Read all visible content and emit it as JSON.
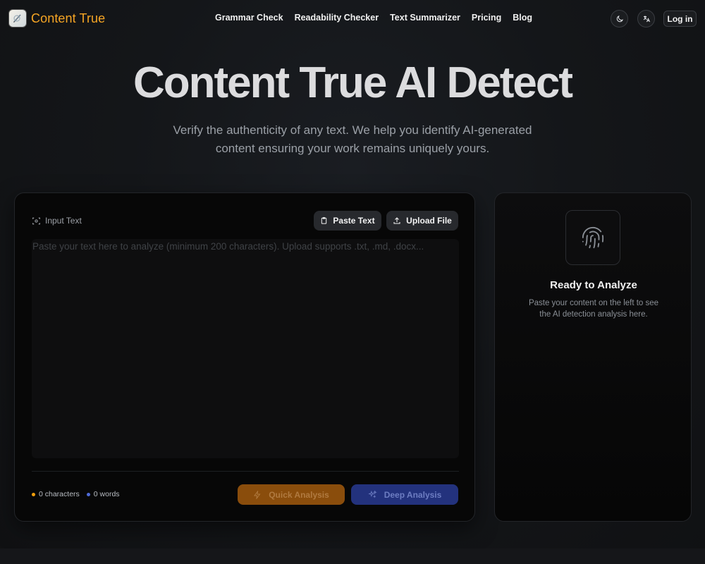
{
  "brand": {
    "name": "Content True"
  },
  "nav": [
    {
      "label": "Grammar Check"
    },
    {
      "label": "Readability Checker"
    },
    {
      "label": "Text Summarizer"
    },
    {
      "label": "Pricing"
    },
    {
      "label": "Blog"
    }
  ],
  "header": {
    "login_label": "Log in",
    "theme_icon": "moon-icon",
    "translate_icon": "translate-icon"
  },
  "hero": {
    "title": "Content True AI Detect",
    "subtitle": "Verify the authenticity of any text. We help you identify AI-generated content ensuring your work remains uniquely yours."
  },
  "input": {
    "label": "Input Text",
    "paste_label": "Paste Text",
    "upload_label": "Upload File",
    "placeholder": "Paste your text here to analyze (minimum 200 characters). Upload supports .txt, .md, .docx...",
    "value": "",
    "characters": "0 characters",
    "words": "0 words",
    "quick_label": "Quick Analysis",
    "deep_label": "Deep Analysis"
  },
  "result": {
    "title": "Ready to Analyze",
    "description": "Paste your content on the left to see the AI detection analysis here."
  },
  "colors": {
    "brand": "#f5a524",
    "quick_button": "#8a4d0c",
    "deep_button": "#23327d",
    "characters_dot": "#f59e0b",
    "words_dot": "#4f6bd8"
  }
}
